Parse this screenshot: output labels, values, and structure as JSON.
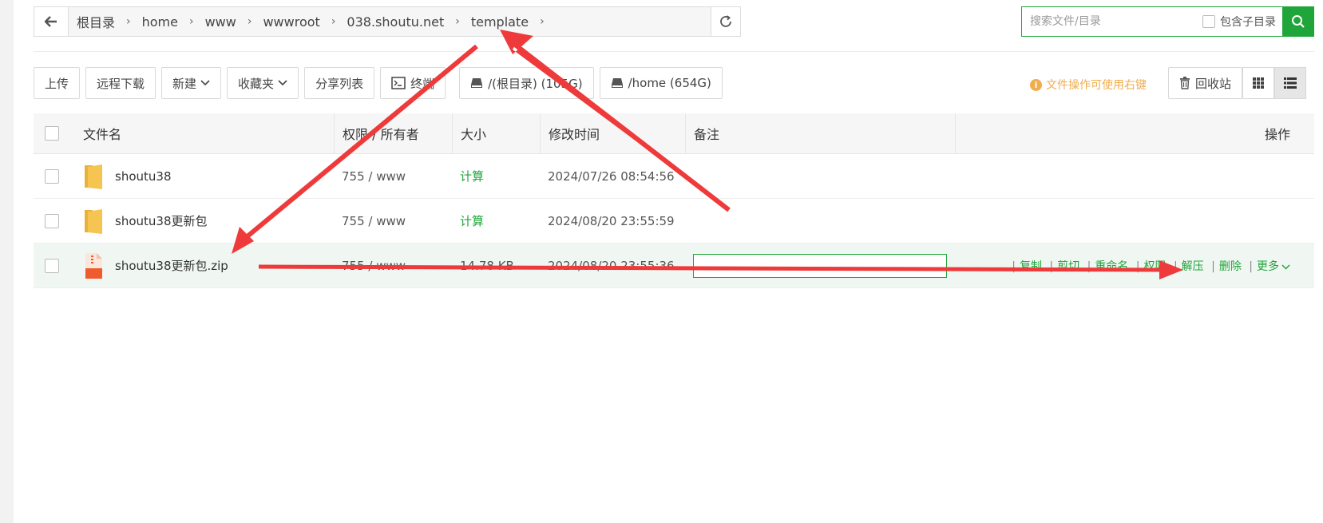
{
  "breadcrumb": {
    "items": [
      "根目录",
      "home",
      "www",
      "wwwroot",
      "038.shoutu.net",
      "template"
    ]
  },
  "search": {
    "placeholder": "搜索文件/目录",
    "subdir_label": "包含子目录"
  },
  "toolbar": {
    "upload": "上传",
    "remote_download": "远程下载",
    "new": "新建",
    "favorites": "收藏夹",
    "share_list": "分享列表",
    "terminal": "终端",
    "disk_root": "/(根目录) (105G)",
    "disk_home": "/home (654G)",
    "hint": "文件操作可使用右键",
    "recycle": "回收站"
  },
  "table": {
    "headers": {
      "name": "文件名",
      "perm": "权限 / 所有者",
      "size": "大小",
      "mtime": "修改时间",
      "note": "备注",
      "ops": "操作"
    },
    "rows": [
      {
        "name": "shoutu38",
        "perm": "755 / www",
        "size": "计算",
        "mtime": "2024/07/26 08:54:56",
        "type": "folder-icon"
      },
      {
        "name": "shoutu38更新包",
        "perm": "755 / www",
        "size": "计算",
        "mtime": "2024/08/20 23:55:59",
        "type": "folder-icon"
      },
      {
        "name": "shoutu38更新包.zip",
        "perm": "755 / www",
        "size": "14.78 KB",
        "mtime": "2024/08/20 23:55:36",
        "type": "zip-file-icon"
      }
    ],
    "row_actions": {
      "copy": "复制",
      "cut": "剪切",
      "rename": "重命名",
      "permission": "权限",
      "unzip": "解压",
      "delete": "删除",
      "more": "更多"
    }
  },
  "colors": {
    "accent": "#20a53a",
    "hint": "#f0ad4e",
    "annotation": "#ee3a3a",
    "folder": "#f5c451",
    "zip": "#ef5b2c"
  }
}
